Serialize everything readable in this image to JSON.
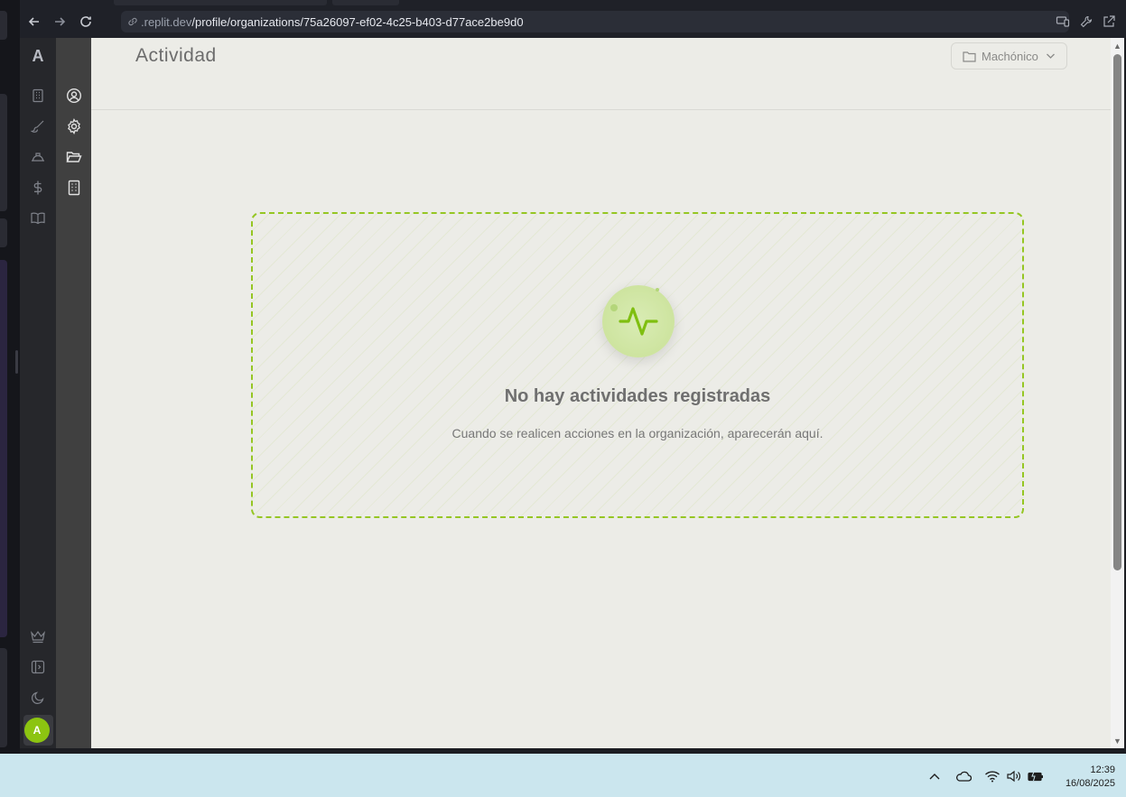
{
  "browser": {
    "url_prefix": ".replit.dev",
    "url_path": "/profile/organizations/75a26097-ef02-4c25-b403-d77ace2be9d0"
  },
  "sidebar": {
    "logo": "A",
    "rail_icons": [
      "building-icon",
      "brush-icon",
      "hard-hat-icon",
      "dollar-icon",
      "book-icon"
    ],
    "bottom_icons": [
      "crown-icon",
      "panel-toggle-icon",
      "moon-icon"
    ],
    "avatar_initial": "A",
    "sub_icons": [
      "user-circle-icon",
      "gear-icon",
      "folder-open-icon",
      "building-icon"
    ]
  },
  "header": {
    "title": "Actividad",
    "org_select": {
      "value": "Machónico",
      "icon": "folder-icon"
    }
  },
  "empty_state": {
    "icon": "activity-pulse-icon",
    "title": "No hay actividades registradas",
    "subtitle": "Cuando se realicen acciones en la organización, aparecerán aquí."
  },
  "taskbar": {
    "time": "12:39",
    "date": "16/08/2025"
  },
  "colors": {
    "accent": "#95c623",
    "main_bg": "#ececE7",
    "taskbar_bg": "#cbe6ee"
  }
}
